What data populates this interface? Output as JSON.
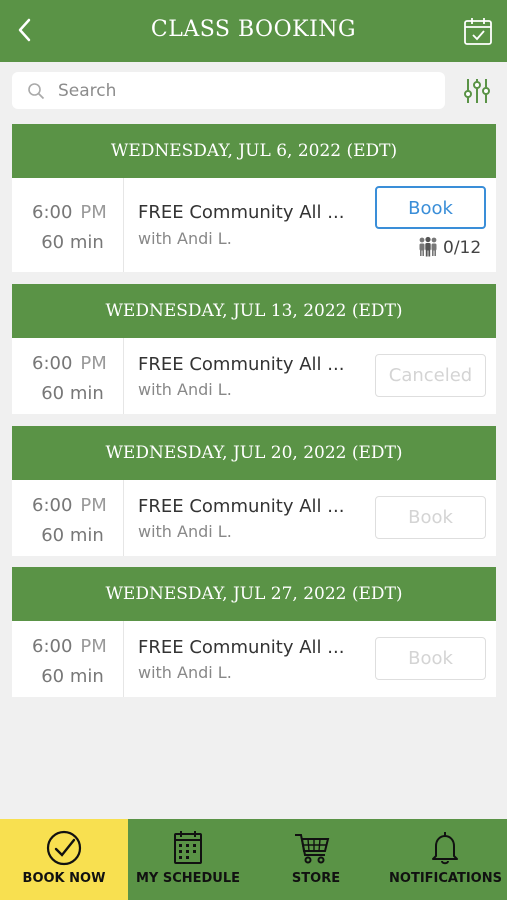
{
  "header": {
    "title": "CLASS BOOKING"
  },
  "search": {
    "placeholder": "Search"
  },
  "days": [
    {
      "date": "WEDNESDAY, JUL 6, 2022 (EDT)",
      "time": "6:00",
      "ampm": "PM",
      "duration": "60 min",
      "class_name": "FREE Community All ...",
      "instructor": "with Andi L.",
      "action": "Book",
      "action_state": "active",
      "capacity": "0/12"
    },
    {
      "date": "WEDNESDAY, JUL 13, 2022 (EDT)",
      "time": "6:00",
      "ampm": "PM",
      "duration": "60 min",
      "class_name": "FREE Community All ...",
      "instructor": "with Andi L.",
      "action": "Canceled",
      "action_state": "disabled"
    },
    {
      "date": "WEDNESDAY, JUL 20, 2022 (EDT)",
      "time": "6:00",
      "ampm": "PM",
      "duration": "60 min",
      "class_name": "FREE Community All ...",
      "instructor": "with Andi L.",
      "action": "Book",
      "action_state": "disabled"
    },
    {
      "date": "WEDNESDAY, JUL 27, 2022 (EDT)",
      "time": "6:00",
      "ampm": "PM",
      "duration": "60 min",
      "class_name": "FREE Community All ...",
      "instructor": "with Andi L.",
      "action": "Book",
      "action_state": "disabled"
    }
  ],
  "nav": [
    {
      "label": "BOOK NOW",
      "icon": "check-circle-icon",
      "active": true
    },
    {
      "label": "MY SCHEDULE",
      "icon": "schedule-icon",
      "active": false
    },
    {
      "label": "STORE",
      "icon": "cart-icon",
      "active": false
    },
    {
      "label": "NOTIFICATIONS",
      "icon": "bell-icon",
      "active": false
    }
  ],
  "colors": {
    "brand_green": "#5a9346",
    "active_tab": "#f8e050",
    "button_blue": "#3a8ed8"
  }
}
